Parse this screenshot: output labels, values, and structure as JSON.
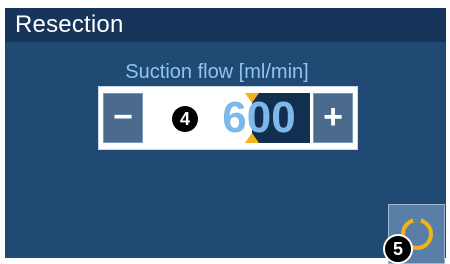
{
  "header": {
    "title": "Resection"
  },
  "suction": {
    "label": "Suction flow [ml/min]",
    "value": "600",
    "decrement_label": "−",
    "increment_label": "+"
  },
  "callouts": {
    "badge_4": "4",
    "badge_5": "5"
  },
  "icons": {
    "cycle": "cycle-ring-icon"
  },
  "colors": {
    "panel": "#204a73",
    "header": "#17345a",
    "value": "#7eb8ea",
    "label": "#8ec5ee",
    "accent": "#f2b21b"
  }
}
